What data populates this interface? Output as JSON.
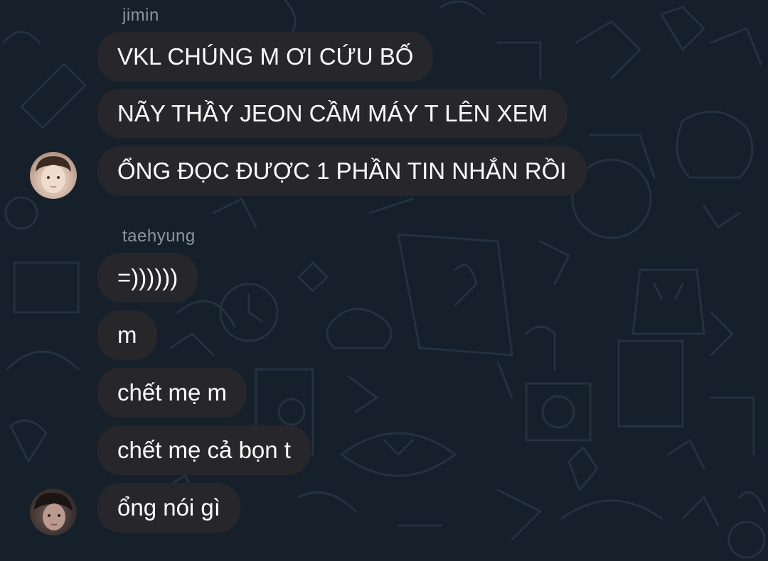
{
  "colors": {
    "background": "#15202a",
    "bubble": "#27262b",
    "text": "#ffffff",
    "sender_name": "#8a959f"
  },
  "messages": [
    {
      "sender": "jimin",
      "avatar_icon": "avatar-jimin",
      "lines": [
        "VKL CHÚNG M ƠI CỨU BỐ",
        "NÃY THẦY JEON CẦM MÁY T LÊN XEM",
        "ỔNG ĐỌC ĐƯỢC 1 PHẦN TIN NHẮN RỒI"
      ]
    },
    {
      "sender": "taehyung",
      "avatar_icon": "avatar-taehyung",
      "lines": [
        "=))))))",
        "m",
        "chết mẹ m",
        "chết mẹ cả bọn t",
        "ổng nói gì"
      ]
    }
  ]
}
